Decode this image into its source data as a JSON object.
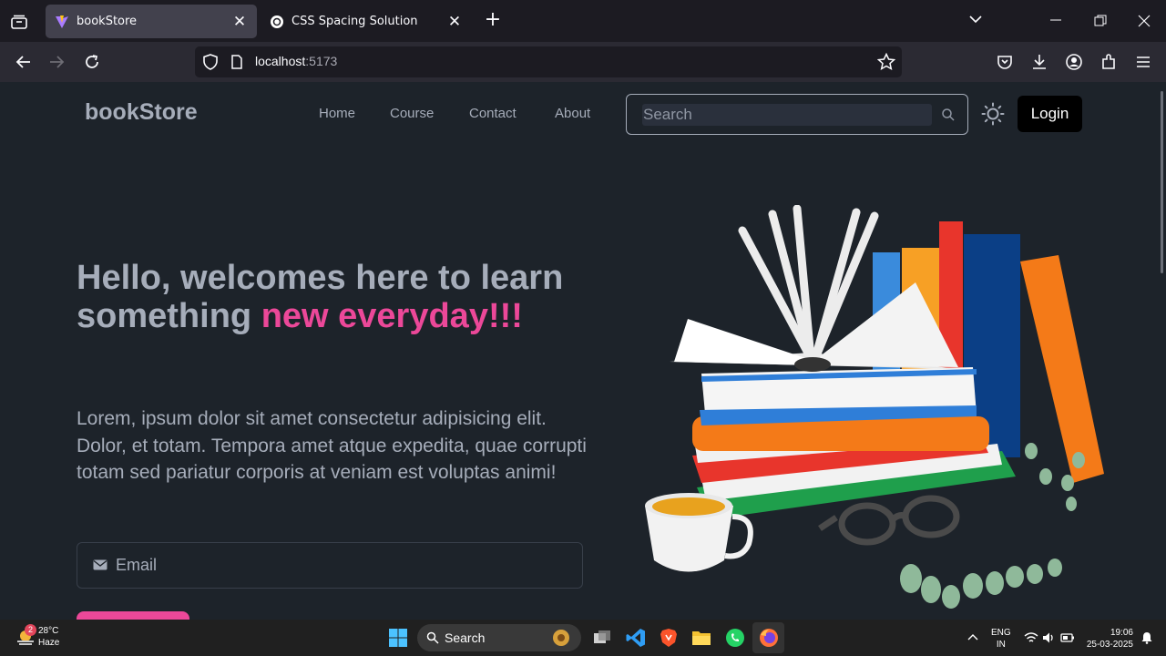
{
  "browser": {
    "tabs": [
      {
        "title": "bookStore",
        "active": true
      },
      {
        "title": "CSS Spacing Solution",
        "active": false
      }
    ],
    "url_host": "localhost",
    "url_port": ":5173"
  },
  "site": {
    "brand": "bookStore",
    "nav": [
      "Home",
      "Course",
      "Contact",
      "About"
    ],
    "search_placeholder": "Search",
    "login_label": "Login",
    "headline_part1": "Hello, welcomes here to learn something ",
    "headline_highlight": "new everyday!!!",
    "paragraph": "Lorem, ipsum dolor sit amet consectetur adipisicing elit. Dolor, et totam. Tempora amet atque expedita, quae corrupti totam sed pariatur corporis at veniam est voluptas animi!",
    "email_placeholder": "Email",
    "accent": "#ec4899"
  },
  "taskbar": {
    "weather_temp": "28°C",
    "weather_desc": "Haze",
    "weather_badge": "2",
    "search_label": "Search",
    "lang": "ENG",
    "region": "IN",
    "time": "19:06",
    "date": "25-03-2025"
  }
}
